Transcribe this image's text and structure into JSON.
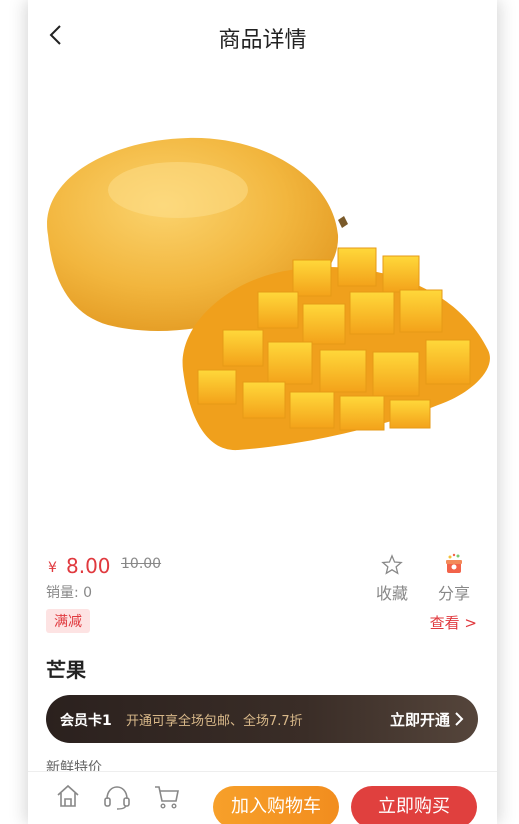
{
  "header": {
    "title": "商品详情"
  },
  "product": {
    "currency": "¥",
    "price": "8.00",
    "old_price": "10.00",
    "sales_label": "销量: 0",
    "name": "芒果",
    "image_icon": "mango-image"
  },
  "actions": {
    "favorite_label": "收藏",
    "share_label": "分享"
  },
  "promotion": {
    "tag": "满减",
    "view": "查看 >"
  },
  "member": {
    "title": "会员卡1",
    "desc": "开通可享全场包邮、全场7.7折",
    "action": "立即开通"
  },
  "subtitle": "新鲜特价",
  "bottom": {
    "add_to_cart": "加入购物车",
    "buy_now": "立即购买"
  },
  "colors": {
    "accent_red": "#e0393e",
    "accent_orange": "#f7a02a",
    "member_bg": "#2b211e",
    "member_text": "#d9b98a"
  }
}
